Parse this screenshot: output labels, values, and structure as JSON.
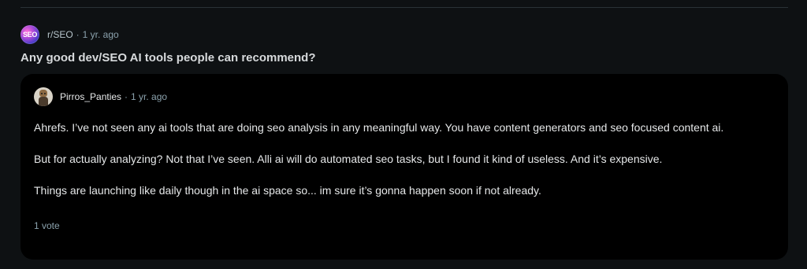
{
  "post": {
    "subreddit": "r/SEO",
    "subreddit_avatar_text": "SEO",
    "separator": "·",
    "time": "1 yr. ago",
    "title": "Any good dev/SEO AI tools people can recommend?"
  },
  "comment": {
    "author": "Pirros_Panties",
    "separator": "·",
    "time": "1 yr. ago",
    "paragraphs": [
      "Ahrefs. I’ve not seen any ai tools that are doing seo analysis in any meaningful way. You have content generators and seo focused content ai.",
      "But for actually analyzing? Not that I’ve seen. Alli ai will do automated seo tasks, but I found it kind of useless. And it’s expensive.",
      "Things are launching like daily though in the ai space so... im sure it’s gonna happen soon if not already."
    ],
    "votes": "1 vote"
  },
  "icons": {
    "subreddit_avatar": "subreddit-avatar-icon",
    "user_avatar": "user-avatar-icon"
  },
  "colors": {
    "background": "#0e1113",
    "card": "#000000",
    "title": "#d7dadc",
    "meta": "#8ba2ad"
  }
}
